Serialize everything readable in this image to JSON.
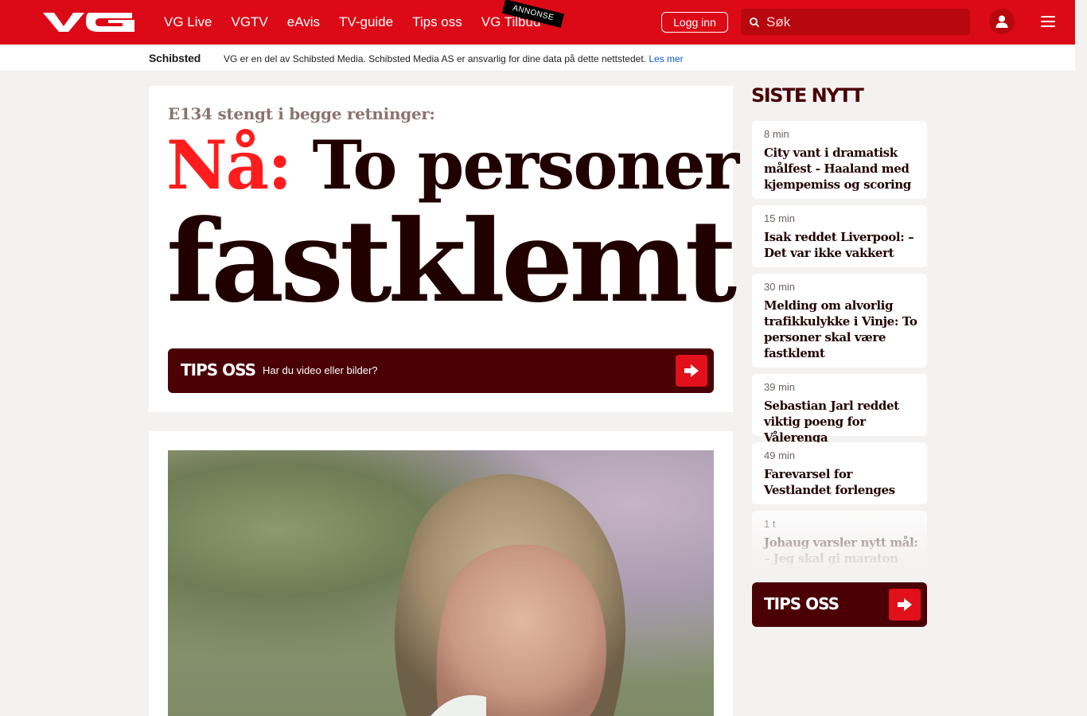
{
  "header": {
    "logo": "VG",
    "nav": [
      "VG Live",
      "VGTV",
      "eAvis",
      "TV-guide",
      "Tips oss",
      "VG Tilbud"
    ],
    "ad_badge": "ANNONSE",
    "login_label": "Logg inn",
    "search_placeholder": "Søk",
    "colors": {
      "brand": "#dc0a16",
      "dark": "#4a0005",
      "accent": "#ff1c1c"
    }
  },
  "schibsted_bar": {
    "logo": "Schibsted",
    "text": "VG er en del av Schibsted Media. Schibsted Media AS er ansvarlig for dine data på dette nettstedet.",
    "link": "Les mer"
  },
  "main": {
    "kicker": "E134 stengt i begge retninger:",
    "headline_prefix": "Nå:",
    "headline_line1": "To personer",
    "headline_line2": "fastklemt",
    "tips": {
      "label": "TIPS OSS",
      "sub": "Har du video eller bilder?"
    }
  },
  "sidebar": {
    "title": "SISTE NYTT",
    "items": [
      {
        "time": "8 min",
        "title": "City vant i dramatisk målfest - Haaland med kjempemiss og scoring"
      },
      {
        "time": "15 min",
        "title": "Isak reddet Liverpool: – Det var ikke vakkert"
      },
      {
        "time": "30 min",
        "title": "Melding om alvorlig trafikkulykke i Vinje: To personer skal være fastklemt"
      },
      {
        "time": "39 min",
        "title": "Sebastian Jarl reddet viktig poeng for Vålerenga"
      },
      {
        "time": "49 min",
        "title": "Farevarsel for Vestlandet forlenges"
      },
      {
        "time": "1 t",
        "title": "Johaug varsler nytt mål: – Jeg skal gi maraton"
      }
    ],
    "tips_label": "TIPS OSS"
  }
}
